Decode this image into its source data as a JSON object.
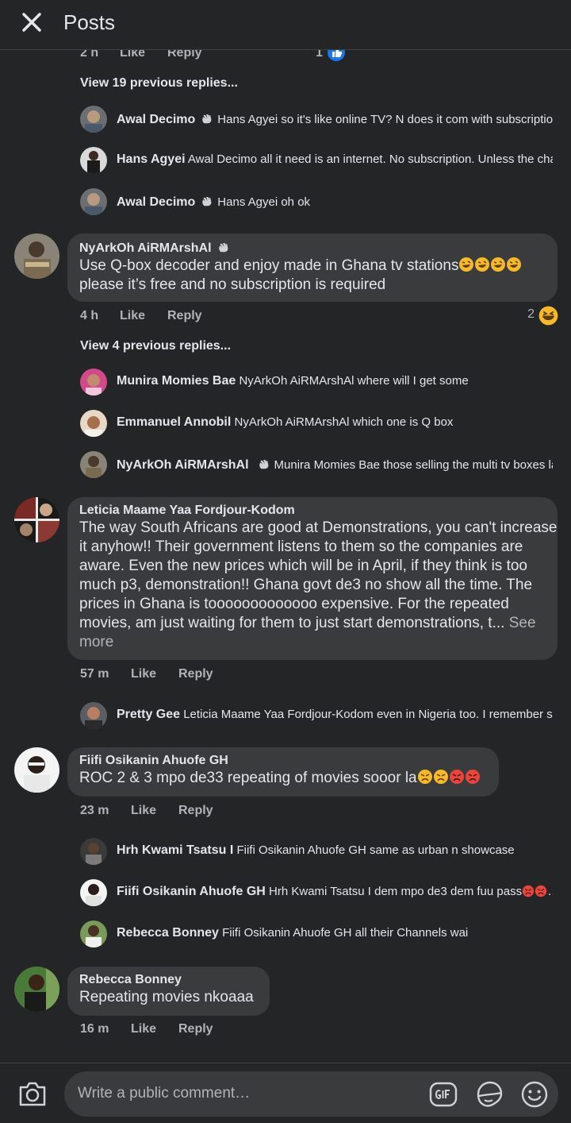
{
  "header": {
    "title": "Posts"
  },
  "first_meta": {
    "time": "2 h",
    "like": "Like",
    "reply": "Reply",
    "count": "1"
  },
  "thread1": {
    "view_more": "View 19 previous replies...",
    "replies": [
      {
        "name": "Awal Decimo",
        "wave": true,
        "text": "Hans Agyei so it's like online TV? N does it com with subscriptio..."
      },
      {
        "name": "Hans Agyei",
        "wave": false,
        "text": "Awal Decimo all it need is an internet. No subscription. Unless the cha..."
      },
      {
        "name": "Awal Decimo",
        "wave": true,
        "text": "Hans Agyei oh ok"
      }
    ]
  },
  "comment2": {
    "author": "NyArkOh AiRMArshAl",
    "text": "Use Q-box decoder and enjoy made in Ghana tv stations",
    "text2": "please it’s free and no subscription is required",
    "time": "4 h",
    "like": "Like",
    "reply": "Reply",
    "reactions": "2",
    "view_more": "View 4 previous replies...",
    "replies": [
      {
        "name": "Munira Momies Bae",
        "text": "NyArkOh AiRMArshAl where will I get some"
      },
      {
        "name": "Emmanuel Annobil",
        "text": "NyArkOh AiRMArshAl which one is Q box"
      },
      {
        "name": "NyArkOh AiRMArshAl",
        "text": "Munira Momies Bae those selling the multi tv boxes la"
      }
    ]
  },
  "comment3": {
    "author": "Leticia Maame Yaa Fordjour-Kodom",
    "lines": [
      "The way South Africans are good at Demonstrations, you can't increase",
      "it anyhow!! Their government listens to them so the companies are",
      "aware. Even the new prices which will be in April, if they think is too",
      "much p3, demonstration!! Ghana govt de3 no show all the time. The",
      "prices in Ghana is tooooooooooooo expensive. For the repeated",
      "movies, am just waiting for them to just start demonstrations, t..."
    ],
    "see_more_a": "See",
    "see_more_b": "more",
    "time": "57 m",
    "like": "Like",
    "reply": "Reply",
    "replies": [
      {
        "name": "Pretty Gee",
        "text": "Leticia Maame Yaa Fordjour-Kodom even in Nigeria too. I remember so..."
      }
    ]
  },
  "comment4": {
    "author": "Fiifi Osikanin Ahuofe GH",
    "text": "ROC 2 & 3 mpo de33 repeating of movies sooor la",
    "time": "23 m",
    "like": "Like",
    "reply": "Reply",
    "replies": [
      {
        "name": "Hrh Kwami Tsatsu I",
        "text": "Fiifi Osikanin Ahuofe GH same as urban n showcase"
      },
      {
        "name": "Fiifi Osikanin Ahuofe GH",
        "text": "Hrh Kwami Tsatsu I dem mpo de3 dem fuu pass"
      },
      {
        "name": "Rebecca Bonney",
        "text": "Fiifi Osikanin Ahuofe GH  all their Channels wai"
      }
    ]
  },
  "comment5": {
    "author": "Rebecca Bonney",
    "text": "Repeating movies nkoaaa",
    "time": "16 m",
    "like": "Like",
    "reply": "Reply"
  },
  "composer": {
    "placeholder": "Write a public comment…"
  },
  "colors": {
    "background": "#242526",
    "bubble": "#3a3b3c",
    "muted": "#b0b3b8",
    "like_blue": "#1877f2"
  },
  "icons": [
    "close-icon",
    "camera-icon",
    "gif-icon",
    "sticker-icon",
    "smile-icon",
    "wave-icon",
    "like-reaction-icon",
    "laughing-emoji",
    "rofl-emoji",
    "angry-emoji"
  ]
}
